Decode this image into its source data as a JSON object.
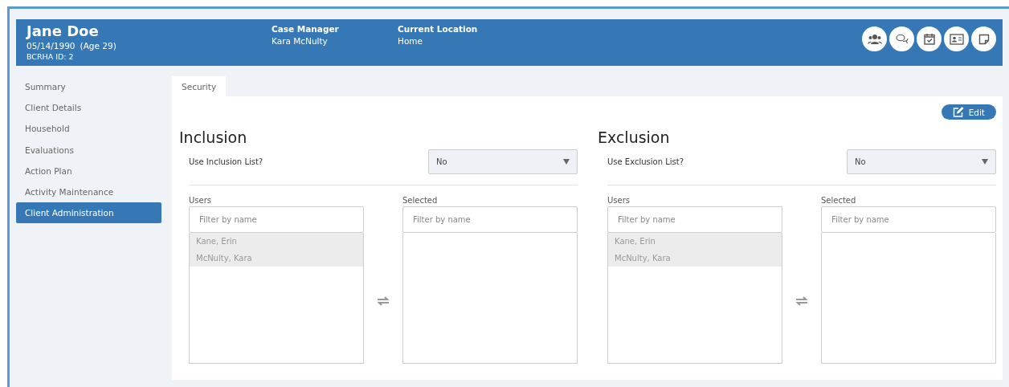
{
  "header": {
    "name": "Jane Doe",
    "dob": "05/14/1990",
    "age": "(Age 29)",
    "id": "BCRHA ID: 2",
    "fields": [
      {
        "label": "Case Manager",
        "value": "Kara McNulty"
      },
      {
        "label": "Current Location",
        "value": "Home"
      }
    ],
    "actions": [
      {
        "kind": "people"
      },
      {
        "kind": "chat"
      },
      {
        "kind": "calendar"
      },
      {
        "kind": "card"
      },
      {
        "kind": "note"
      }
    ]
  },
  "sidebar": {
    "items": [
      {
        "label": "Summary",
        "selected": false
      },
      {
        "label": "Client Details",
        "selected": false
      },
      {
        "label": "Household",
        "selected": false
      },
      {
        "label": "Evaluations",
        "selected": false
      },
      {
        "label": "Action Plan",
        "selected": false
      },
      {
        "label": "Activity Maintenance",
        "selected": false
      },
      {
        "label": "Client Administration",
        "selected": true
      }
    ]
  },
  "tabs": [
    {
      "label": "Security",
      "selected": true
    }
  ],
  "edit_button": "Edit",
  "sections": [
    {
      "title": "Inclusion",
      "question": "Use Inclusion List?",
      "value": "No",
      "users_label": "Users",
      "selected_label": "Selected",
      "users_placeholder": "Filter by name",
      "selected_placeholder": "Filter by name",
      "users": [
        {
          "name": "Kane, Erin",
          "disabled": true
        },
        {
          "name": "McNulty, Kara",
          "disabled": true
        }
      ]
    },
    {
      "title": "Exclusion",
      "question": "Use Exclusion List?",
      "value": "No",
      "users_label": "Users",
      "selected_label": "Selected",
      "users_placeholder": "Filter by name",
      "selected_placeholder": "Filter by name",
      "users": [
        {
          "name": "Kane, Erin",
          "disabled": true
        },
        {
          "name": "McNulty, Kara",
          "disabled": true
        }
      ]
    }
  ]
}
